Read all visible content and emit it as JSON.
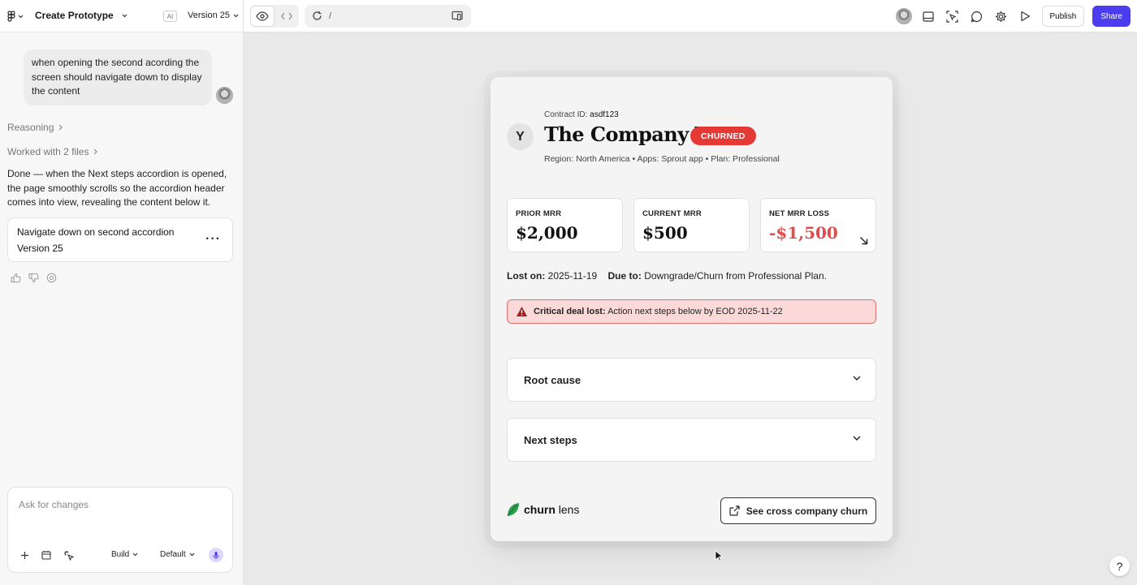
{
  "topbar": {
    "project_title": "Create Prototype",
    "ai_badge": "AI",
    "version": "Version 25",
    "url_path": "/",
    "publish_label": "Publish",
    "share_label": "Share"
  },
  "chat": {
    "user_message": "when opening the second acording the screen should navigate down to display the content",
    "reasoning_label": "Reasoning",
    "worked_label": "Worked with 2 files",
    "response": "Done — when the Next steps accordion is opened, the page smoothly scrolls so the accordion header comes into view, revealing the content below it.",
    "version_card": {
      "title": "Navigate down on second accordion",
      "subtitle": "Version 25"
    }
  },
  "composer": {
    "placeholder": "Ask for changes",
    "mode": "Build",
    "model": "Default"
  },
  "preview": {
    "contract_label": "Contract ID:",
    "contract_id": "asdf123",
    "initial": "Y",
    "company_name": "The Company Y",
    "status_badge": "CHURNED",
    "meta": "Region: North America • Apps: Sprout app • Plan: Professional",
    "metrics": [
      {
        "label": "PRIOR MRR",
        "value": "$2,000"
      },
      {
        "label": "CURRENT MRR",
        "value": "$500"
      },
      {
        "label": "NET MRR LOSS",
        "value": "-$1,500"
      }
    ],
    "lost_on_label": "Lost on:",
    "lost_on_value": "2025-11-19",
    "due_to_label": "Due to:",
    "due_to_value": "Downgrade/Churn from Professional Plan.",
    "alert_bold": "Critical deal lost:",
    "alert_text": "Action next steps below by EOD 2025-11-22",
    "accordions": [
      "Root cause",
      "Next steps"
    ],
    "brand_bold": "churn",
    "brand_light": "lens",
    "cross_button": "See cross company churn"
  },
  "help_label": "?",
  "colors": {
    "accent": "#4c3cf0",
    "churned": "#e53935",
    "loss": "#e24b4b",
    "alert_bg": "#fcd9d9",
    "brand_leaf": "#2e9e4f"
  }
}
